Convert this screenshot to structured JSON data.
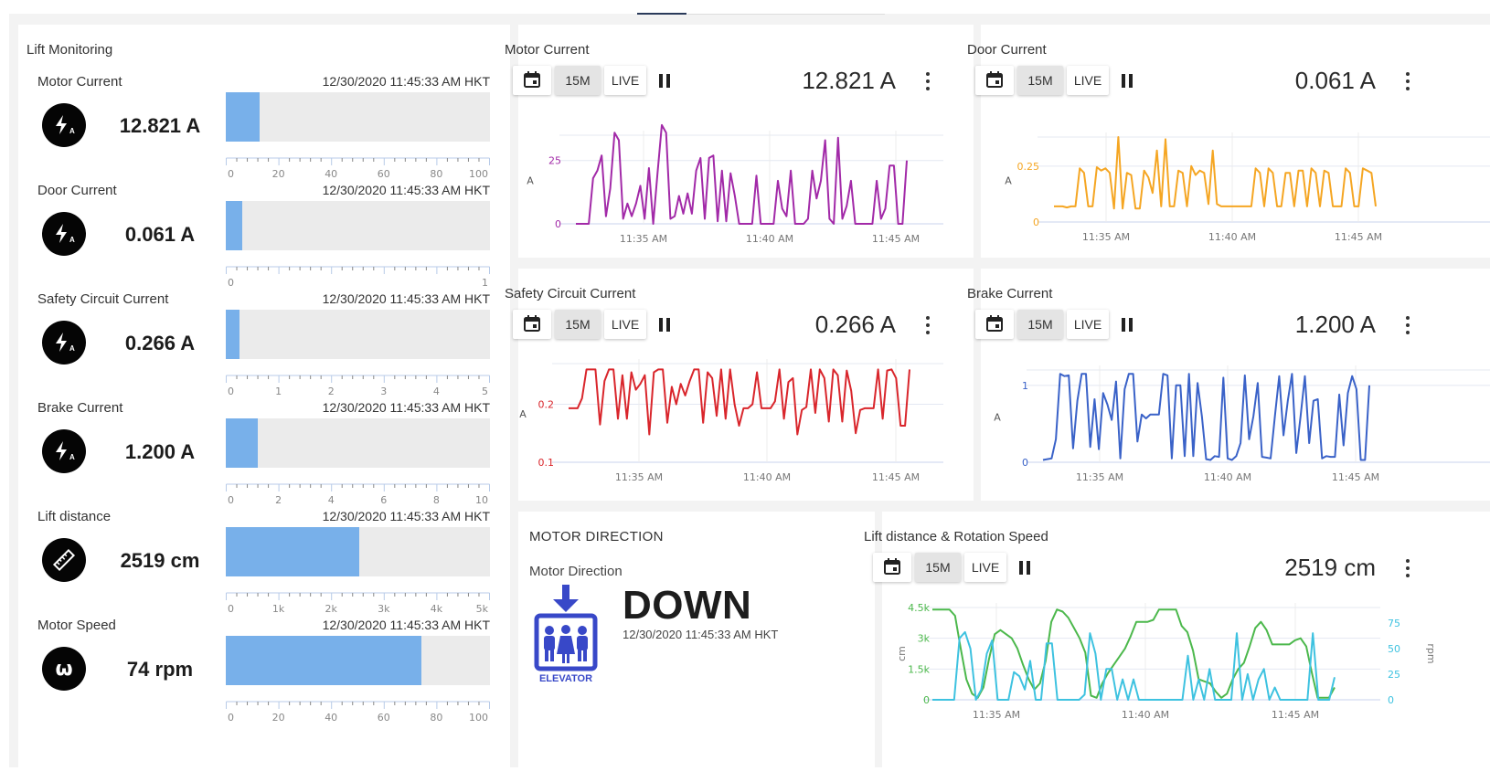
{
  "lift_monitoring": {
    "title": "Lift Monitoring",
    "metrics": [
      {
        "label": "Motor Current",
        "timestamp": "12/30/2020 11:45:33 AM HKT",
        "value": "12.821 A",
        "icon": "amperage-bolt-icon",
        "gauge_value": 12.821,
        "gauge_max": 100,
        "ticks": [
          "0",
          "20",
          "40",
          "60",
          "80",
          "100"
        ]
      },
      {
        "label": "Door Current",
        "timestamp": "12/30/2020 11:45:33 AM HKT",
        "value": "0.061 A",
        "icon": "amperage-bolt-icon",
        "gauge_value": 0.061,
        "gauge_max": 1,
        "ticks": [
          "0",
          "",
          "",
          "",
          "",
          "1"
        ]
      },
      {
        "label": "Safety Circuit Current",
        "timestamp": "12/30/2020 11:45:33 AM HKT",
        "value": "0.266 A",
        "icon": "amperage-bolt-icon",
        "gauge_value": 0.266,
        "gauge_max": 5,
        "ticks": [
          "0",
          "1",
          "2",
          "3",
          "4",
          "5"
        ]
      },
      {
        "label": "Brake Current",
        "timestamp": "12/30/2020 11:45:33 AM HKT",
        "value": "1.200 A",
        "icon": "amperage-bolt-icon",
        "gauge_value": 1.2,
        "gauge_max": 10,
        "ticks": [
          "0",
          "2",
          "4",
          "6",
          "8",
          "10"
        ]
      },
      {
        "label": "Lift distance",
        "timestamp": "12/30/2020 11:45:33 AM HKT",
        "value": "2519 cm",
        "icon": "ruler-icon",
        "gauge_value": 2519,
        "gauge_max": 5000,
        "ticks": [
          "0",
          "1k",
          "2k",
          "3k",
          "4k",
          "5k"
        ]
      },
      {
        "label": "Motor Speed",
        "timestamp": "12/30/2020 11:45:33 AM HKT",
        "value": "74 rpm",
        "icon": "omega-icon",
        "gauge_value": 74,
        "gauge_max": 100,
        "ticks": [
          "0",
          "20",
          "40",
          "60",
          "80",
          "100"
        ]
      }
    ]
  },
  "controls": {
    "calendar_icon": "calendar-icon",
    "period_label": "15M",
    "live_label": "LIVE",
    "pause_icon": "pause-icon",
    "menu_icon": "more-vert-icon"
  },
  "motor_direction": {
    "title": "MOTOR DIRECTION",
    "caption": "Motor Direction",
    "value": "DOWN",
    "timestamp": "12/30/2020 11:45:33 AM HKT",
    "icon": "elevator-down-icon",
    "icon_label": "ELEVATOR"
  },
  "colors": {
    "gauge_fill": "#78b0ea",
    "motor_current": "#a22aa8",
    "door_current": "#f5a623",
    "safety_circuit": "#d9262c",
    "brake_current": "#3a62c8",
    "lift_distance": "#4cb84c",
    "rotation_speed": "#3ec2e0",
    "elevator_icon": "#3848c8"
  },
  "chart_data": [
    {
      "id": "motor",
      "type": "line",
      "title": "Motor Current",
      "current_value": "12.821 A",
      "ylabel": "A",
      "yticks": [
        0,
        25
      ],
      "ylim": [
        0,
        35
      ],
      "xticks": [
        "11:35 AM",
        "11:40 AM",
        "11:45 AM"
      ],
      "series": [
        {
          "name": "Motor Current",
          "color": "#a22aa8",
          "values": [
            0,
            0,
            0,
            0,
            18,
            21,
            27,
            3,
            14,
            36,
            33,
            2,
            8,
            3,
            8,
            15,
            2,
            22,
            0,
            20,
            39,
            36,
            2,
            3,
            11,
            4,
            12,
            4,
            21,
            26,
            2,
            26,
            27,
            1,
            21,
            1,
            20,
            11,
            0,
            0,
            0,
            0,
            19,
            0,
            0,
            0,
            0,
            17,
            6,
            3,
            21,
            0,
            0,
            0,
            2,
            21,
            10,
            17,
            33,
            2,
            0,
            34,
            2,
            7,
            17,
            0,
            0,
            0,
            0,
            0,
            17,
            2,
            6,
            23,
            23,
            0,
            0,
            25
          ]
        }
      ]
    },
    {
      "id": "door",
      "type": "line",
      "title": "Door Current",
      "current_value": "0.061 A",
      "ylabel": "A",
      "yticks": [
        0,
        0.25
      ],
      "ylim": [
        0,
        0.38
      ],
      "xticks": [
        "11:35 AM",
        "11:40 AM",
        "11:45 AM"
      ],
      "series": [
        {
          "name": "Door Current",
          "color": "#f5a623",
          "values": [
            0.07,
            0.07,
            0.07,
            0.065,
            0.07,
            0.07,
            0.24,
            0.22,
            0.07,
            0.07,
            0.245,
            0.23,
            0.24,
            0.22,
            0.06,
            0.38,
            0.06,
            0.22,
            0.21,
            0.06,
            0.06,
            0.23,
            0.2,
            0.13,
            0.32,
            0.07,
            0.37,
            0.07,
            0.07,
            0.23,
            0.22,
            0.07,
            0.25,
            0.21,
            0.23,
            0.22,
            0.08,
            0.32,
            0.08,
            0.07,
            0.07,
            0.07,
            0.07,
            0.07,
            0.07,
            0.07,
            0.07,
            0.24,
            0.22,
            0.07,
            0.24,
            0.22,
            0.07,
            0.07,
            0.22,
            0.22,
            0.07,
            0.23,
            0.23,
            0.07,
            0.24,
            0.22,
            0.07,
            0.23,
            0.22,
            0.07,
            0.07,
            0.07,
            0.24,
            0.22,
            0.07,
            0.07,
            0.24,
            0.23,
            0.22,
            0.07
          ]
        }
      ]
    },
    {
      "id": "safety",
      "type": "line",
      "title": "Safety Circuit Current",
      "current_value": "0.266 A",
      "ylabel": "A",
      "yticks": [
        0.1,
        0.2
      ],
      "ylim": [
        0.1,
        0.27
      ],
      "xticks": [
        "11:35 AM",
        "11:40 AM",
        "11:45 AM"
      ],
      "series": [
        {
          "name": "Safety Circuit Current",
          "color": "#d9262c",
          "values": [
            0.193,
            0.193,
            0.193,
            0.21,
            0.26,
            0.26,
            0.26,
            0.165,
            0.24,
            0.26,
            0.26,
            0.175,
            0.25,
            0.175,
            0.255,
            0.225,
            0.235,
            0.25,
            0.148,
            0.255,
            0.26,
            0.26,
            0.168,
            0.23,
            0.2,
            0.235,
            0.215,
            0.24,
            0.26,
            0.26,
            0.168,
            0.255,
            0.245,
            0.18,
            0.26,
            0.175,
            0.26,
            0.2,
            0.163,
            0.193,
            0.193,
            0.2,
            0.255,
            0.193,
            0.193,
            0.193,
            0.205,
            0.26,
            0.175,
            0.238,
            0.245,
            0.148,
            0.19,
            0.195,
            0.26,
            0.185,
            0.26,
            0.245,
            0.17,
            0.26,
            0.25,
            0.17,
            0.258,
            0.223,
            0.15,
            0.19,
            0.193,
            0.193,
            0.193,
            0.26,
            0.175,
            0.258,
            0.26,
            0.245,
            0.163,
            0.163,
            0.26
          ]
        }
      ]
    },
    {
      "id": "brake",
      "type": "line",
      "title": "Brake Current",
      "current_value": "1.200 A",
      "ylabel": "A",
      "yticks": [
        0,
        1
      ],
      "ylim": [
        0,
        1.2
      ],
      "xticks": [
        "11:35 AM",
        "11:40 AM",
        "11:45 AM"
      ],
      "series": [
        {
          "name": "Brake Current",
          "color": "#3a62c8",
          "values": [
            0.03,
            0.04,
            0.05,
            0.3,
            1.15,
            1.12,
            1.13,
            0.18,
            0.8,
            1.15,
            1.15,
            0.2,
            0.82,
            0.17,
            0.9,
            0.75,
            0.55,
            1.05,
            0.05,
            0.95,
            1.15,
            1.15,
            0.27,
            0.62,
            0.57,
            0.62,
            0.62,
            0.62,
            1.15,
            1.13,
            0.05,
            1.0,
            1.0,
            0.08,
            1.15,
            0.08,
            1.03,
            0.6,
            0.04,
            0.03,
            0.08,
            0.07,
            1.1,
            0.05,
            0.03,
            0.08,
            0.25,
            1.13,
            0.3,
            0.6,
            1.03,
            0.07,
            0.06,
            0.05,
            0.6,
            1.12,
            0.35,
            0.8,
            1.15,
            0.12,
            0.6,
            1.12,
            0.25,
            0.8,
            0.82,
            0.05,
            0.08,
            0.07,
            0.07,
            0.88,
            0.22,
            0.9,
            1.12,
            0.95,
            0.03,
            0.03,
            1.0
          ]
        }
      ]
    },
    {
      "id": "distance",
      "type": "line",
      "title": "Lift distance & Rotation Speed",
      "current_value": "2519 cm",
      "ylabel": "cm",
      "y2label": "rpm",
      "yticks": [
        "0",
        "1.5k",
        "3k",
        "4.5k"
      ],
      "y2ticks": [
        "0",
        "25",
        "50",
        "75"
      ],
      "ylim": [
        0,
        4500
      ],
      "y2lim": [
        0,
        90
      ],
      "xticks": [
        "11:35 AM",
        "11:40 AM",
        "11:45 AM"
      ],
      "series": [
        {
          "name": "Lift distance",
          "axis": "left",
          "color": "#4cb84c",
          "values": [
            4400,
            4400,
            4400,
            4400,
            4100,
            2500,
            1000,
            300,
            100,
            600,
            2000,
            3200,
            3400,
            3200,
            3000,
            2500,
            1700,
            1000,
            500,
            800,
            1900,
            3800,
            4400,
            4300,
            4000,
            3500,
            3000,
            2300,
            200,
            100,
            800,
            1300,
            1700,
            2100,
            2500,
            3100,
            3800,
            3800,
            3800,
            3900,
            4400,
            4400,
            4400,
            4400,
            3600,
            3300,
            2400,
            1000,
            900,
            800,
            400,
            100,
            300,
            1000,
            1500,
            1800,
            2600,
            3500,
            3800,
            3400,
            2700,
            2700,
            2700,
            2700,
            2900,
            3000,
            2600,
            1300,
            100,
            100,
            100,
            600
          ]
        },
        {
          "name": "Rotation Speed",
          "axis": "right",
          "color": "#3ec2e0",
          "values": [
            0,
            0,
            0,
            0,
            0,
            60,
            66,
            50,
            0,
            10,
            45,
            58,
            0,
            0,
            0,
            27,
            23,
            10,
            38,
            0,
            0,
            55,
            55,
            0,
            0,
            0,
            0,
            0,
            5,
            65,
            45,
            0,
            30,
            30,
            0,
            20,
            0,
            20,
            0,
            0,
            0,
            0,
            0,
            0,
            0,
            0,
            0,
            43,
            0,
            20,
            0,
            30,
            0,
            0,
            0,
            0,
            65,
            0,
            25,
            0,
            20,
            30,
            0,
            12,
            0,
            0,
            0,
            0,
            0,
            0,
            65,
            0,
            0,
            0,
            22
          ]
        }
      ]
    }
  ]
}
